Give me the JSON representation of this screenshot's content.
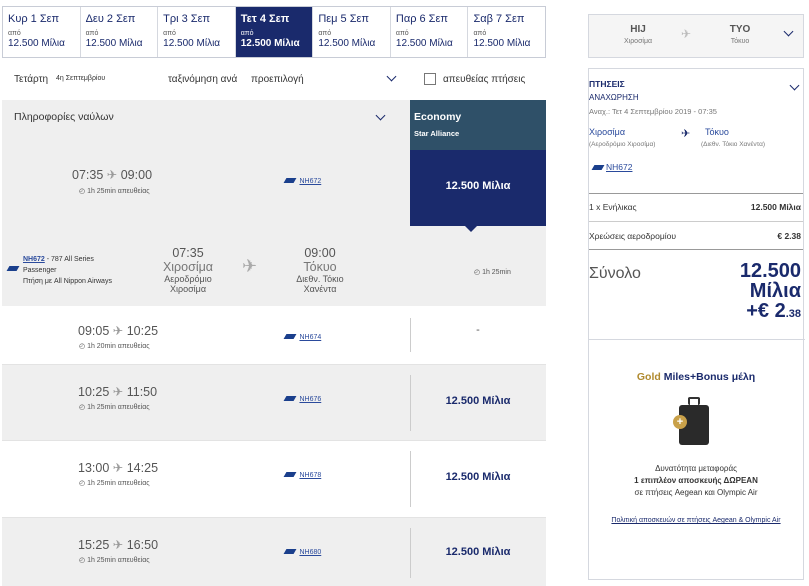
{
  "date_tabs": [
    {
      "day": "Κυρ 1 Σεπ",
      "from": "από",
      "miles": "12.500 Μίλια",
      "selected": false
    },
    {
      "day": "Δευ 2 Σεπ",
      "from": "από",
      "miles": "12.500 Μίλια",
      "selected": false
    },
    {
      "day": "Τρι 3 Σεπ",
      "from": "από",
      "miles": "12.500 Μίλια",
      "selected": false
    },
    {
      "day": "Τετ 4 Σεπ",
      "from": "από",
      "miles": "12.500 Μίλια",
      "selected": true
    },
    {
      "day": "Πεμ 5 Σεπ",
      "from": "από",
      "miles": "12.500 Μίλια",
      "selected": false
    },
    {
      "day": "Παρ 6 Σεπ",
      "from": "από",
      "miles": "12.500 Μίλια",
      "selected": false
    },
    {
      "day": "Σαβ 7 Σεπ",
      "from": "από",
      "miles": "12.500 Μίλια",
      "selected": false
    }
  ],
  "filter": {
    "weekday": "Τετάρτη",
    "date": "4η Σεπτεμβρίου",
    "sort_label": "ταξινόμηση ανά",
    "sort_value": "προεπιλογή",
    "direct_label": "απευθείας πτήσεις"
  },
  "header": {
    "fare_info": "Πληροφορίες ναύλων",
    "cabin": "Economy",
    "alliance": "Star Alliance"
  },
  "flights": [
    {
      "dep": "07:35",
      "arr": "09:00",
      "duration": "1h 25min απευθείας",
      "flight": "NH672",
      "price": "12.500 Μίλια"
    },
    {
      "dep": "09:05",
      "arr": "10:25",
      "duration": "1h 20min απευθείας",
      "flight": "NH674",
      "price": "-"
    },
    {
      "dep": "10:25",
      "arr": "11:50",
      "duration": "1h 25min απευθείας",
      "flight": "NH676",
      "price": "12.500 Μίλια"
    },
    {
      "dep": "13:00",
      "arr": "14:25",
      "duration": "1h 25min απευθείας",
      "flight": "NH678",
      "price": "12.500 Μίλια"
    },
    {
      "dep": "15:25",
      "arr": "16:50",
      "duration": "1h 25min απευθείας",
      "flight": "NH680",
      "price": "12.500 Μίλια"
    }
  ],
  "detail": {
    "flight": "NH672",
    "aircraft": "- 787 All Series",
    "type": "Passenger",
    "operated": "Πτήση με All Nippon Airways",
    "dep_time": "07:35",
    "dep_city": "Χιροσίμα",
    "dep_airport_1": "Αεροδρόμιο",
    "dep_airport_2": "Χιροσίμα",
    "arr_time": "09:00",
    "arr_city": "Τόκυο",
    "arr_airport_1": "Διεθν. Τόκιο",
    "arr_airport_2": "Χανέντα",
    "duration": "1h 25min"
  },
  "summary": {
    "from_code": "HIJ",
    "from_city": "Χιροσίμα",
    "to_code": "TYO",
    "to_city": "Τόκυο",
    "flights_title": "ΠΤΗΣΕΙΣ",
    "departure_title": "ΑΝΑΧΩΡΗΣΗ",
    "departure_date": "Αναχ.: Τετ 4 Σεπτεμβρίου 2019 - 07:35",
    "seg_from_city": "Χιροσίμα",
    "seg_from_airport": "(Αεροδρόμιο Χιροσίμα)",
    "seg_to_city": "Τόκυο",
    "seg_to_airport": "(Διεθν. Τόκιο Χανέντα)",
    "seg_flight": "NH672",
    "adult_label": "1 x Ενήλικας",
    "adult_value": "12.500 Μίλια",
    "fees_label": "Χρεώσεις αεροδρομίου",
    "fees_value": "€ 2.38",
    "total_label": "Σύνολο",
    "total_miles": "12.500",
    "total_unit": "Μίλια",
    "total_plus": "+€ 2",
    "total_cents": ".38"
  },
  "promo": {
    "gold": "Gold",
    "title_rest": "Miles+Bonus μέλη",
    "line1": "Δυνατότητα μεταφοράς",
    "line2": "1 επιπλέον αποσκευής ΔΩΡΕΑΝ",
    "line3": "σε πτήσεις Aegean και Olympic Air",
    "link": "Πολιτική αποσκευών σε πτήσεις Aegean & Olympic Air"
  }
}
